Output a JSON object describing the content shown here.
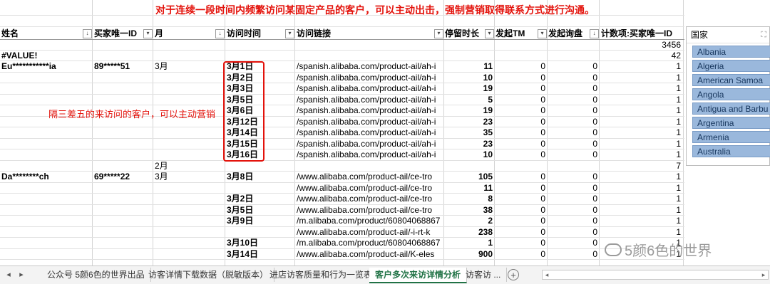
{
  "banner_text": "对于连续一段时间内频繁访问某固定产品的客户，可以主动出击，强制营销取得联系方式进行沟通。",
  "headers": {
    "name": "姓名",
    "buyer_id": "买家唯一ID",
    "month": "月",
    "visit_time": "访问时间",
    "visit_link": "访问链接",
    "stay": "停留时长",
    "tm": "发起TM",
    "inquiry": "发起询盘",
    "count": "计数项:买家唯一ID"
  },
  "annotation_text": "隔三差五的来访问的客户，可以主动营销",
  "top_rows": [
    {
      "name": "",
      "count": "3456"
    },
    {
      "name": "#VALUE!",
      "count": "42"
    }
  ],
  "rows": [
    {
      "name": "Eu***********ia",
      "id": "89*****51",
      "month": "3月",
      "date": "3月1日",
      "link": "/spanish.alibaba.com/product-ail/ah-i",
      "stay": "11",
      "tm": "0",
      "inq": "0",
      "count": "1"
    },
    {
      "name": "",
      "id": "",
      "month": "",
      "date": "3月2日",
      "link": "/spanish.alibaba.com/product-ail/ah-i",
      "stay": "10",
      "tm": "0",
      "inq": "0",
      "count": "1"
    },
    {
      "name": "",
      "id": "",
      "month": "",
      "date": "3月3日",
      "link": "/spanish.alibaba.com/product-ail/ah-i",
      "stay": "19",
      "tm": "0",
      "inq": "0",
      "count": "1"
    },
    {
      "name": "",
      "id": "",
      "month": "",
      "date": "3月5日",
      "link": "/spanish.alibaba.com/product-ail/ah-i",
      "stay": "5",
      "tm": "0",
      "inq": "0",
      "count": "1"
    },
    {
      "name": "",
      "id": "",
      "month": "",
      "date": "3月6日",
      "link": "/spanish.alibaba.com/product-ail/ah-i",
      "stay": "19",
      "tm": "0",
      "inq": "0",
      "count": "1"
    },
    {
      "name": "",
      "id": "",
      "month": "",
      "date": "3月12日",
      "link": "/spanish.alibaba.com/product-ail/ah-i",
      "stay": "23",
      "tm": "0",
      "inq": "0",
      "count": "1"
    },
    {
      "name": "",
      "id": "",
      "month": "",
      "date": "3月14日",
      "link": "/spanish.alibaba.com/product-ail/ah-i",
      "stay": "35",
      "tm": "0",
      "inq": "0",
      "count": "1"
    },
    {
      "name": "",
      "id": "",
      "month": "",
      "date": "3月15日",
      "link": "/spanish.alibaba.com/product-ail/ah-i",
      "stay": "23",
      "tm": "0",
      "inq": "0",
      "count": "1"
    },
    {
      "name": "",
      "id": "",
      "month": "",
      "date": "3月16日",
      "link": "/spanish.alibaba.com/product-ail/ah-i",
      "stay": "10",
      "tm": "0",
      "inq": "0",
      "count": "1"
    },
    {
      "name": "",
      "id": "",
      "month": "2月",
      "date": "",
      "link": "",
      "stay": "",
      "tm": "",
      "inq": "",
      "count": "7"
    },
    {
      "name": "Da********ch",
      "id": "69*****22",
      "month": "3月",
      "date": "3月8日",
      "link": "/www.alibaba.com/product-ail/ce-tro",
      "stay": "105",
      "tm": "0",
      "inq": "0",
      "count": "1"
    },
    {
      "name": "",
      "id": "",
      "month": "",
      "date": "",
      "link": "/www.alibaba.com/product-ail/ce-tro",
      "stay": "11",
      "tm": "0",
      "inq": "0",
      "count": "1"
    },
    {
      "name": "",
      "id": "",
      "month": "",
      "date": "3月2日",
      "link": "/www.alibaba.com/product-ail/ce-tro",
      "stay": "8",
      "tm": "0",
      "inq": "0",
      "count": "1"
    },
    {
      "name": "",
      "id": "",
      "month": "",
      "date": "3月5日",
      "link": "/www.alibaba.com/product-ail/ce-tro",
      "stay": "38",
      "tm": "0",
      "inq": "0",
      "count": "1"
    },
    {
      "name": "",
      "id": "",
      "month": "",
      "date": "3月9日",
      "link": "/m.alibaba.com/product/60804068867",
      "stay": "2",
      "tm": "0",
      "inq": "0",
      "count": "1"
    },
    {
      "name": "",
      "id": "",
      "month": "",
      "date": "",
      "link": "/www.alibaba.com/product-ail/-i-rt-k",
      "stay": "238",
      "tm": "0",
      "inq": "0",
      "count": "1"
    },
    {
      "name": "",
      "id": "",
      "month": "",
      "date": "3月10日",
      "link": "/m.alibaba.com/product/60804068867",
      "stay": "1",
      "tm": "0",
      "inq": "0",
      "count": "1"
    },
    {
      "name": "",
      "id": "",
      "month": "",
      "date": "3月14日",
      "link": "/www.alibaba.com/product-ail/K-eles",
      "stay": "900",
      "tm": "0",
      "inq": "0",
      "count": "1"
    }
  ],
  "slicer": {
    "title": "国家",
    "items": [
      "Albania",
      "Algeria",
      "American Samoa",
      "Angola",
      "Antigua and Barbu",
      "Argentina",
      "Armenia",
      "Australia"
    ]
  },
  "watermark": "5颜6色的世界",
  "tabs": [
    {
      "label": "公众号 5颜6色的世界出品",
      "active": false
    },
    {
      "label": "访客详情下载数据（脱敏版本）",
      "active": false
    },
    {
      "label": "进店访客质量和行为一览表",
      "active": false
    },
    {
      "label": "客户多次来访详情分析",
      "active": true
    },
    {
      "label": "访客访 ...",
      "active": false
    }
  ],
  "icons": {
    "filter": "filter-dropdown-icon",
    "sort": "sort-icon",
    "clear_filter": "clear-filter-icon",
    "add_sheet": "plus-circle-icon",
    "nav_prev": "triangle-left-icon",
    "nav_next": "triangle-right-icon"
  },
  "colors": {
    "accent_red": "#e3120b",
    "slicer_selected": "#9ab8dc",
    "active_tab": "#217346"
  }
}
